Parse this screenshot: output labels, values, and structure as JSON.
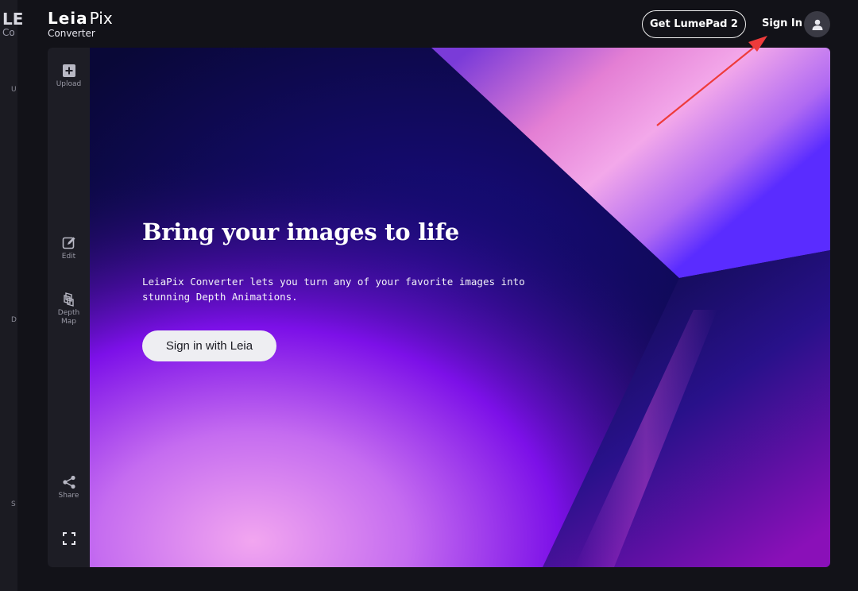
{
  "background_app": {
    "logo": "LE",
    "sub": "Co",
    "letters": [
      "U",
      "D",
      "S"
    ]
  },
  "header": {
    "logo_leia": "Leia",
    "logo_pix": "Pix",
    "logo_sub": "Converter",
    "lumepad_label": "Get LumePad 2",
    "signin_label": "Sign In",
    "avatar_icon": "user-icon"
  },
  "sidebar": {
    "items": [
      {
        "label": "Upload",
        "icon": "plus-square-icon"
      },
      {
        "label": "Edit",
        "icon": "edit-icon"
      },
      {
        "label": "Depth Map",
        "icon": "layers-icon"
      },
      {
        "label": "Share",
        "icon": "share-icon"
      },
      {
        "label": "",
        "icon": "fullscreen-icon"
      }
    ]
  },
  "hero": {
    "title": "Bring your images to life",
    "description": "LeiaPix Converter lets you turn any of your favorite images into stunning Depth Animations.",
    "button_label": "Sign in with Leia"
  },
  "annotation": {
    "arrow_color": "#ee3b3b"
  }
}
